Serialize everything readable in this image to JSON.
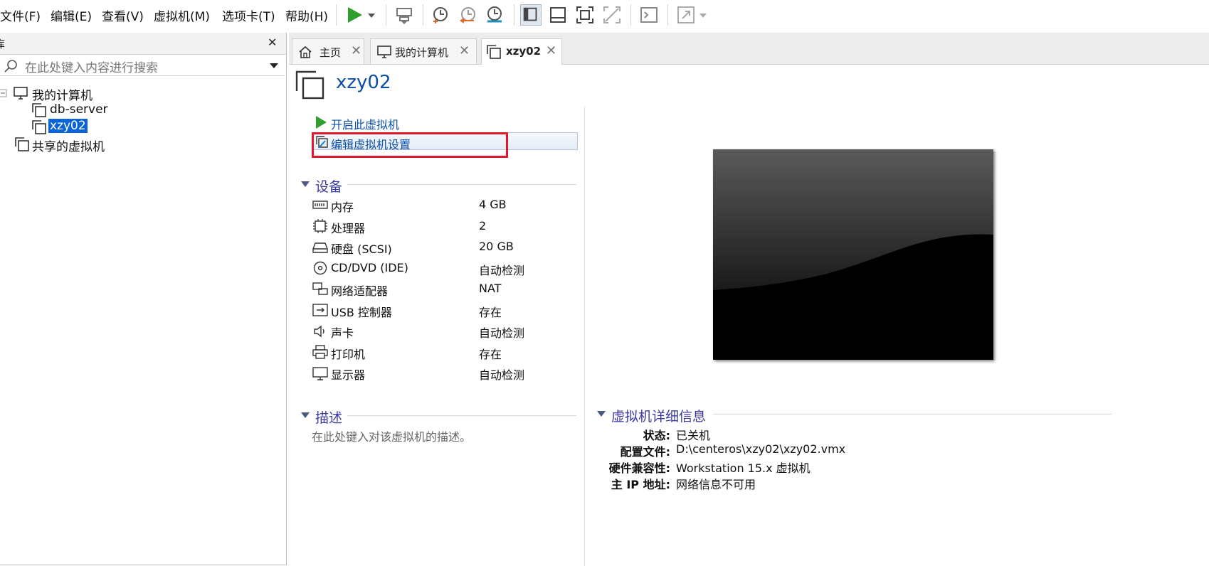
{
  "menu": {
    "items": [
      "文件(F)",
      "编辑(E)",
      "查看(V)",
      "虚拟机(M)",
      "选项卡(T)",
      "帮助(H)"
    ]
  },
  "toolbar": {
    "icons": [
      "play-icon",
      "dropdown-arrow-icon",
      "send-ctrl-alt-del-icon",
      "snapshot-take-icon",
      "snapshot-revert-icon",
      "snapshot-manager-icon",
      "show-library-icon",
      "thumbnail-bar-icon",
      "full-screen-icon",
      "unity-icon",
      "console-view-icon",
      "stretch-guest-icon"
    ]
  },
  "library": {
    "header_label": "库",
    "close": "✕",
    "search_placeholder": "在此处键入内容进行搜索",
    "tree": {
      "root": "我的计算机",
      "children": [
        "db-server",
        "xzy02"
      ],
      "shared": "共享的虚拟机"
    }
  },
  "tabs": [
    {
      "label": "主页",
      "icon": "home-icon"
    },
    {
      "label": "我的计算机",
      "icon": "computer-icon"
    },
    {
      "label": "xzy02",
      "icon": "vm-icon"
    }
  ],
  "vm": {
    "name": "xzy02",
    "actions": {
      "power_on": "开启此虚拟机",
      "edit_settings": "编辑虚拟机设置"
    }
  },
  "devices": {
    "title": "设备",
    "items": [
      {
        "name": "内存",
        "value": "4 GB",
        "icon": "memory-icon"
      },
      {
        "name": "处理器",
        "value": "2",
        "icon": "processor-icon"
      },
      {
        "name": "硬盘 (SCSI)",
        "value": "20 GB",
        "icon": "hard-disk-icon"
      },
      {
        "name": "CD/DVD (IDE)",
        "value": "自动检测",
        "icon": "cd-dvd-icon"
      },
      {
        "name": "网络适配器",
        "value": "NAT",
        "icon": "network-adapter-icon"
      },
      {
        "name": "USB 控制器",
        "value": "存在",
        "icon": "usb-icon"
      },
      {
        "name": "声卡",
        "value": "自动检测",
        "icon": "sound-icon"
      },
      {
        "name": "打印机",
        "value": "存在",
        "icon": "printer-icon"
      },
      {
        "name": "显示器",
        "value": "自动检测",
        "icon": "display-icon"
      }
    ]
  },
  "description": {
    "title": "描述",
    "placeholder": "在此处键入对该虚拟机的描述。"
  },
  "details": {
    "title": "虚拟机详细信息",
    "rows": [
      {
        "label": "状态:",
        "value": "已关机"
      },
      {
        "label": "配置文件:",
        "value": "D:\\centeros\\xzy02\\xzy02.vmx"
      },
      {
        "label": "硬件兼容性:",
        "value": "Workstation 15.x 虚拟机"
      },
      {
        "label": "主 IP 地址:",
        "value": "网络信息不可用"
      }
    ]
  },
  "colors": {
    "accent": "#0b4fa8",
    "section_title": "#3a3aa0",
    "play_green": "#2e9e2e",
    "highlight_red": "#e0182d",
    "selection_blue": "#0a64d6"
  }
}
